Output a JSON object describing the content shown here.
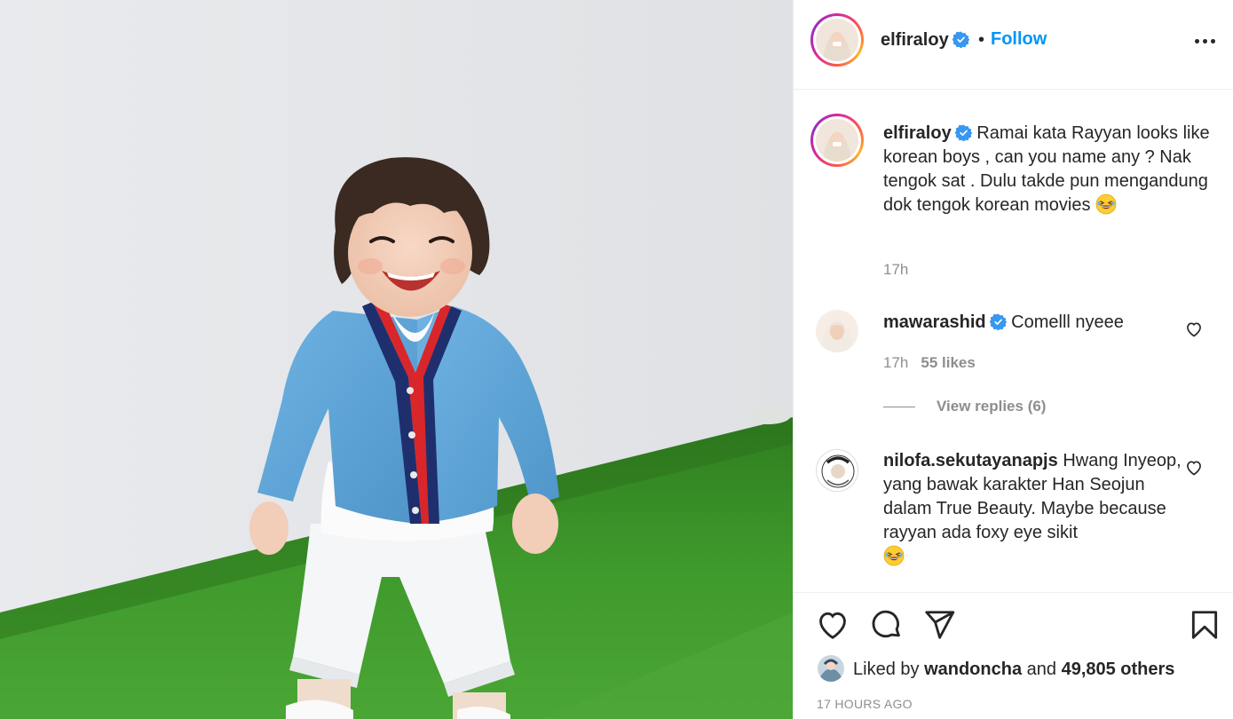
{
  "post": {
    "image_alt": "Smiling toddler in blue cardigan standing on artificial grass"
  },
  "header": {
    "username": "elfiraloy",
    "separator": "•",
    "follow_label": "Follow"
  },
  "caption": {
    "username": "elfiraloy",
    "text": "Ramai kata Rayyan looks like korean boys , can you name any ? Nak tengok sat . Dulu takde pun mengandung dok tengok korean movies",
    "emoji": "grinning-squinting-face-with-tears",
    "time": "17h"
  },
  "comments": [
    {
      "username": "mawarashid",
      "verified": true,
      "text": "Comelll nyeee",
      "time": "17h",
      "likes": "55 likes",
      "view_replies": "View replies (6)"
    },
    {
      "username": "nilofa.sekutayanapjs",
      "verified": false,
      "text": "Hwang Inyeop, yang bawak karakter Han Seojun dalam True Beauty. Maybe because rayyan ada foxy eye sikit",
      "emoji": "grinning-squinting-face-with-tears",
      "avatar_text": "MILKYDIP.CO"
    }
  ],
  "likes": {
    "prefix": "Liked by",
    "user": "wandoncha",
    "and": "and",
    "others": "49,805 others"
  },
  "timestamp": "17 HOURS AGO",
  "colors": {
    "accent": "#0095f6",
    "verified": "#3897f0",
    "text": "#262626",
    "muted": "#8e8e8e",
    "grass": "#3f9a2c"
  },
  "icons": [
    "verified-badge-icon",
    "more-options-icon",
    "heart-icon",
    "comment-icon",
    "share-icon",
    "bookmark-icon",
    "laughing-emoji-icon"
  ]
}
